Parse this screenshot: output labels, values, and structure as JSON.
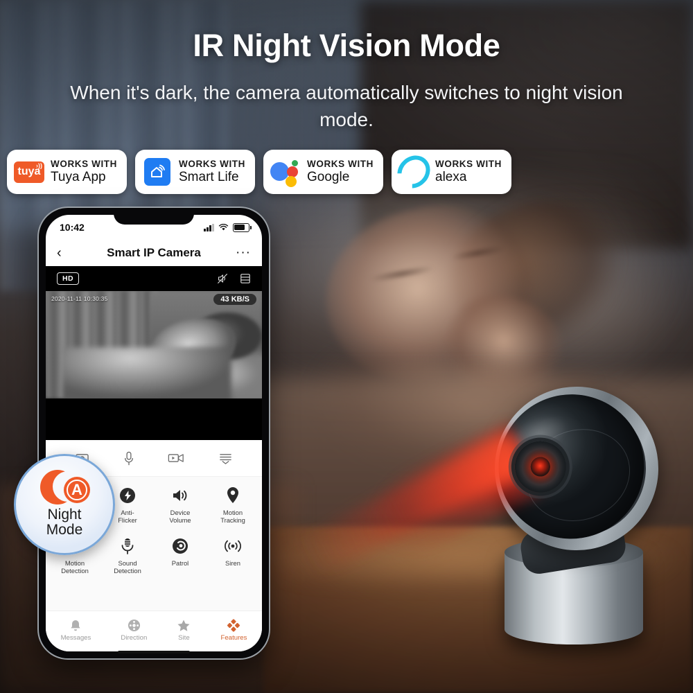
{
  "headline": "IR Night Vision Mode",
  "subhead": "When it's dark, the camera automatically switches to night vision mode.",
  "colors": {
    "accent_orange": "#ef5a28",
    "tab_active": "#d2622f",
    "badge_border_blue": "#7aa7d8",
    "tuya_orange": "#ef5a28",
    "smartlife_blue": "#1f7cf2",
    "alexa_cyan": "#25c3e8",
    "google_blue": "#4285f4",
    "google_red": "#ea4335",
    "google_green": "#34a853",
    "google_yellow": "#fbbc05",
    "ir_red": "#ff3b1f"
  },
  "badges": [
    {
      "works_with": "WORKS WITH",
      "name": "Tuya App",
      "logo": "tuya-logo",
      "logo_text": "tuya"
    },
    {
      "works_with": "WORKS WITH",
      "name": "Smart Life",
      "logo": "smart-life-home-icon",
      "logo_text": ""
    },
    {
      "works_with": "WORKS WITH",
      "name": "Google",
      "logo": "google-assistant-dots-icon",
      "logo_text": ""
    },
    {
      "works_with": "WORKS WITH",
      "name": "alexa",
      "logo": "alexa-ring-icon",
      "logo_text": ""
    }
  ],
  "phone": {
    "statusbar": {
      "time": "10:42",
      "signal_icon": "cellular-signal-icon",
      "wifi_icon": "wifi-icon",
      "battery_icon": "battery-icon"
    },
    "navbar": {
      "back_icon": "chevron-left-icon",
      "title": "Smart IP Camera",
      "more_icon": "more-horizontal-icon"
    },
    "videobar": {
      "quality": "HD",
      "mute_icon": "speaker-muted-icon",
      "layout_icon": "multi-screen-icon"
    },
    "video": {
      "timestamp": "2020-11-11 10:30:35",
      "bitrate": "43 KB/S"
    },
    "quick_actions": [
      {
        "name": "screenshot",
        "icon": "screenshot-camera-icon"
      },
      {
        "name": "talk",
        "icon": "microphone-icon"
      },
      {
        "name": "record",
        "icon": "video-record-icon"
      },
      {
        "name": "playback",
        "icon": "playback-list-icon"
      }
    ],
    "features_row1": [
      {
        "label": "",
        "icon": ""
      },
      {
        "label": "Anti-\nFlicker",
        "label_line1": "Anti-",
        "label_line2": "Flicker",
        "icon": "bolt-icon"
      },
      {
        "label": "Device\nVolume",
        "label_line1": "Device",
        "label_line2": "Volume",
        "icon": "speaker-volume-icon"
      },
      {
        "label": "Motion\nTracking",
        "label_line1": "Motion",
        "label_line2": "Tracking",
        "icon": "location-pin-icon"
      }
    ],
    "features_row2": [
      {
        "label_line1": "Motion",
        "label_line2": "Detection",
        "icon": "walking-person-icon"
      },
      {
        "label_line1": "Sound",
        "label_line2": "Detection",
        "icon": "studio-microphone-icon"
      },
      {
        "label_line1": "Patrol",
        "label_line2": "",
        "icon": "patrol-disc-icon"
      },
      {
        "label_line1": "Siren",
        "label_line2": "",
        "icon": "siren-waves-icon"
      }
    ],
    "tabs": [
      {
        "label": "Messages",
        "icon": "bell-icon",
        "active": false
      },
      {
        "label": "Direction",
        "icon": "dpad-icon",
        "active": false
      },
      {
        "label": "Site",
        "icon": "star-icon",
        "active": false
      },
      {
        "label": "Features",
        "icon": "diamond-grid-icon",
        "active": true
      }
    ]
  },
  "night_badge": {
    "line1": "Night",
    "line2": "Mode",
    "icon": "night-mode-auto-moon-icon"
  },
  "device": {
    "name": "ip-camera-device",
    "lens_icon": "camera-lens-icon",
    "beam": "ir-red-beam"
  }
}
